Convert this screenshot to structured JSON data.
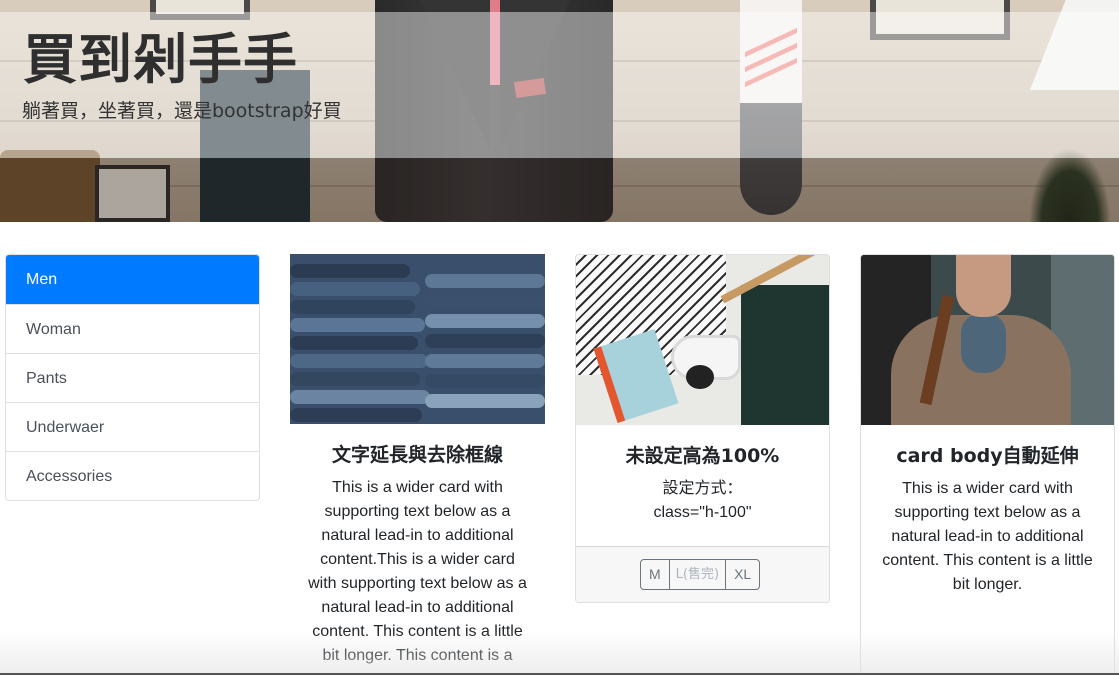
{
  "hero": {
    "title": "買到剁手手",
    "subtitle": "躺著買，坐著買，還是bootstrap好買"
  },
  "sidebar": {
    "items": [
      {
        "label": "Men",
        "active": true
      },
      {
        "label": "Woman",
        "active": false
      },
      {
        "label": "Pants",
        "active": false
      },
      {
        "label": "Underwaer",
        "active": false
      },
      {
        "label": "Accessories",
        "active": false
      }
    ]
  },
  "cards": [
    {
      "image": "jeans-stack-image",
      "title": "文字延長與去除框線",
      "text": "This is a wider card with supporting text below as a natural lead-in to additional content.This is a wider card with supporting text below as a natural lead-in to additional content. This content is a little bit longer. This content is a"
    },
    {
      "image": "flatlay-outfit-image",
      "title": "未設定高為100%",
      "text_line1": "設定方式：",
      "text_line2": "class=\"h-100\"",
      "sizes": [
        {
          "label": "M",
          "disabled": false
        },
        {
          "label": "L(售完)",
          "disabled": true
        },
        {
          "label": "XL",
          "disabled": false
        }
      ]
    },
    {
      "image": "man-in-coat-image",
      "title": "card body自動延伸",
      "text": "This is a wider card with supporting text below as a natural lead-in to additional content. This content is a little bit longer."
    }
  ],
  "colors": {
    "primary": "#007bff",
    "secondary": "#6c757d",
    "text": "#212529"
  }
}
